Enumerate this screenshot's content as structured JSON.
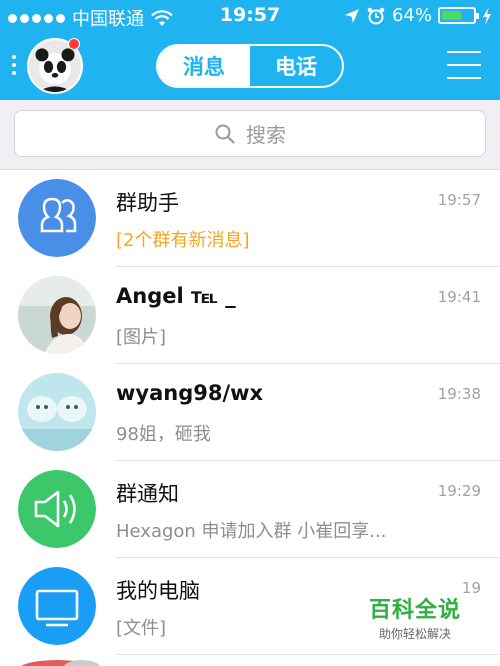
{
  "status_bar": {
    "carrier": "中国联通",
    "time": "19:57",
    "battery": "64%",
    "battery_level": 0.64
  },
  "header": {
    "tabs": [
      {
        "label": "消息",
        "active": true
      },
      {
        "label": "电话",
        "active": false
      }
    ]
  },
  "search": {
    "placeholder": "搜索"
  },
  "conversations": [
    {
      "name": "群助手",
      "time": "19:57",
      "message": "[2个群有新消息]",
      "highlight": true,
      "avatar": "group-helper-icon",
      "color": "#4a8fe7"
    },
    {
      "name": "Angel ℡ _",
      "time": "19:41",
      "message": "[图片]",
      "highlight": false,
      "avatar": "photo-avatar-girl"
    },
    {
      "name": "wyang98/wx",
      "time": "19:38",
      "message": "98姐，砸我",
      "highlight": false,
      "avatar": "photo-avatar-birds"
    },
    {
      "name": "群通知",
      "time": "19:29",
      "message": "Hexagon 申请加入群 小崔回享...",
      "highlight": false,
      "avatar": "speaker-icon",
      "color": "#3cc86a"
    },
    {
      "name": "我的电脑",
      "time": "19",
      "message": "[文件]",
      "highlight": false,
      "avatar": "monitor-icon",
      "color": "#1a9ef5"
    }
  ],
  "watermark": {
    "title": "百科全说",
    "subtitle": "助你轻松解决"
  },
  "colors": {
    "header": "#1fb3f0",
    "highlight": "#f5a623"
  }
}
